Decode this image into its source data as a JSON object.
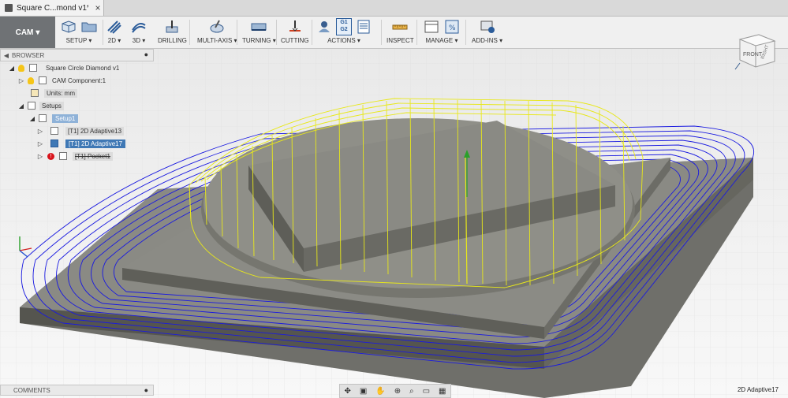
{
  "tab": {
    "title": "Square C...mond v1*"
  },
  "toolbar": {
    "workspace": "CAM",
    "groups": [
      {
        "label": "SETUP",
        "arrow": "▾"
      },
      {
        "label": "2D",
        "arrow": "▾"
      },
      {
        "label": "3D",
        "arrow": "▾"
      },
      {
        "label": "DRILLING",
        "arrow": ""
      },
      {
        "label": "MULTI-AXIS",
        "arrow": "▾"
      },
      {
        "label": "TURNING",
        "arrow": "▾"
      },
      {
        "label": "CUTTING",
        "arrow": ""
      },
      {
        "label": "ACTIONS",
        "arrow": "▾"
      },
      {
        "label": "INSPECT",
        "arrow": ""
      },
      {
        "label": "MANAGE",
        "arrow": "▾"
      },
      {
        "label": "ADD-INS",
        "arrow": "▾"
      }
    ],
    "g1g2": {
      "g1": "G1",
      "g2": "G2"
    }
  },
  "browser": {
    "header": "BROWSER",
    "root": "Square Circle Diamond v1",
    "component": "CAM Component:1",
    "units": "Units: mm",
    "setups": "Setups",
    "setup1": "Setup1",
    "op1": "[T1] 2D Adaptive13",
    "op2": "[T1] 2D Adaptive17",
    "op3": "[T1] Pocket1"
  },
  "comments": {
    "header": "COMMENTS"
  },
  "viewcube": {
    "front": "FRONT",
    "right": "RIGHT"
  },
  "status": {
    "selected": "2D Adaptive17"
  },
  "colors": {
    "toolpath_blue": "#1a1ae0",
    "toolpath_yellow": "#e8e81a",
    "selection": "#3f78b5",
    "workspace": "#6f7275"
  }
}
